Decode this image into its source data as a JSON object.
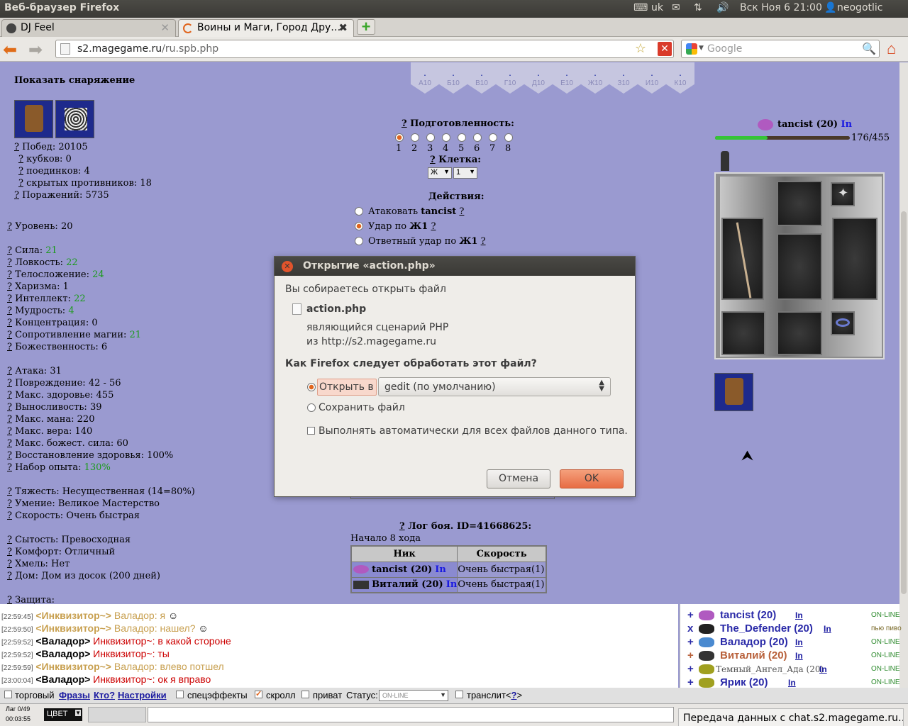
{
  "panel": {
    "title": "Веб-браузер Firefox",
    "keyboard": "uk",
    "datetime": "Вск Ноя 6 21:00",
    "user": "neogotlic"
  },
  "tabs": [
    {
      "label": "DJ Feel"
    },
    {
      "label": "Воины и Маги, Город Дру…"
    }
  ],
  "nav": {
    "url_domain": "s2.magegame.ru",
    "url_path": "/ru.spb.php",
    "search_placeholder": "Google"
  },
  "left": {
    "show_gear": "Показать снаряжение",
    "stats": [
      {
        "label": "Побед: ",
        "value": "20105"
      },
      {
        "label": "кубков: ",
        "value": "0"
      },
      {
        "label": "поединков: ",
        "value": "4"
      },
      {
        "label": "скрытых противников: ",
        "value": "18"
      },
      {
        "label": "Поражений: ",
        "value": "5735"
      },
      {
        "label": "Уровень: ",
        "value": "20"
      },
      {
        "label": "Сила: ",
        "value": "21"
      },
      {
        "label": "Ловкость: ",
        "value": "22"
      },
      {
        "label": "Телосложение: ",
        "value": "24"
      },
      {
        "label": "Харизма: ",
        "value": "1"
      },
      {
        "label": "Интеллект: ",
        "value": "22"
      },
      {
        "label": "Мудрость: ",
        "value": "4"
      },
      {
        "label": "Концентрация: ",
        "value": "0"
      },
      {
        "label": "Сопротивление магии: ",
        "value": "21"
      },
      {
        "label": "Божественность: ",
        "value": "6"
      },
      {
        "label": "Атака: ",
        "value": "31"
      },
      {
        "label": "Повреждение: ",
        "value": "42 - 56"
      },
      {
        "label": "Макс. здоровье: ",
        "value": "455"
      },
      {
        "label": "Выносливость: ",
        "value": "39"
      },
      {
        "label": "Макс. мана: ",
        "value": "220"
      },
      {
        "label": "Макс. вера: ",
        "value": "140"
      },
      {
        "label": "Макс. божест. сила: ",
        "value": "60"
      },
      {
        "label": "Восстановление здоровья: ",
        "value": "100%"
      },
      {
        "label": "Набор опыта: ",
        "value": "130%"
      },
      {
        "label": "Тяжесть: ",
        "value": "Несущественная (14=80%)"
      },
      {
        "label": "Умение: ",
        "value": "Великое Мастерство"
      },
      {
        "label": "Скорость: ",
        "value": "Очень быстрая"
      },
      {
        "label": "Сытость: ",
        "value": "Превосходная"
      },
      {
        "label": "Комфорт: ",
        "value": "Отличный"
      },
      {
        "label": "Хмель: ",
        "value": "Нет"
      },
      {
        "label": "Дом: ",
        "value": "Дом из досок (200 дней)"
      },
      {
        "label": "Защита:",
        "value": ""
      }
    ]
  },
  "cells": [
    "А10",
    "Б10",
    "В10",
    "Г10",
    "Д10",
    "Е10",
    "Ж10",
    "З10",
    "И10",
    "К10"
  ],
  "prep": {
    "title": "Подготовленность:",
    "levels": [
      "1",
      "2",
      "3",
      "4",
      "5",
      "6",
      "7",
      "8"
    ],
    "cell_title": "Клетка:",
    "cell_col": "Ж",
    "cell_row": "1"
  },
  "actions": {
    "title": "Действия:",
    "a1": "Атаковать ",
    "a1b": "tancist",
    "a2": "Удар по ",
    "a2b": "Ж1",
    "a3": "Ответный удар по ",
    "a3b": "Ж1"
  },
  "player": {
    "name": "tancist (20)",
    "link": "In",
    "hp": "176/455",
    "hp_fraction": 0.387
  },
  "log": {
    "title": "Лог боя. ID=41668625:",
    "turn": "Начало 8 хода",
    "col_nick": "Ник",
    "col_speed": "Скорость",
    "rows": [
      {
        "nick": "tancist (20)",
        "link": "In",
        "speed": "Очень быстрая(1)"
      },
      {
        "nick": "Виталий (20)",
        "link": "In",
        "speed": "Очень быстрая(1)"
      }
    ]
  },
  "chat": [
    {
      "time": "[22:59:45]",
      "nick": "<Инквизитор~>",
      "msg": " Валадор: я",
      "inq": true
    },
    {
      "time": "[22:59:50]",
      "nick": "<Инквизитор~>",
      "msg": " Валадор: нашел?",
      "inq": true
    },
    {
      "time": "[22:59:52]",
      "nick": "<Валадор>",
      "msg": " Инквизитор~: в какой стороне",
      "inq": false
    },
    {
      "time": "[22:59:52]",
      "nick": "<Валадор>",
      "msg": " Инквизитор~: ты",
      "inq": false
    },
    {
      "time": "[22:59:59]",
      "nick": "<Инквизитор~>",
      "msg": " Валадор: влево потшел",
      "inq": true
    },
    {
      "time": "[23:00:04]",
      "nick": "<Валадор>",
      "msg": " Инквизитор~: ок я вправо",
      "inq": false
    }
  ],
  "users": [
    {
      "sign": "+",
      "name": "tancist (20)",
      "link": "In",
      "status": "ON-LINE"
    },
    {
      "sign": "x",
      "name": "The_Defender (20)",
      "link": "In",
      "status": "пью пиво"
    },
    {
      "sign": "+",
      "name": "Валадор (20)",
      "link": "In",
      "status": "ON-LINE"
    },
    {
      "sign": "+",
      "name": "Виталий (20)",
      "link": "In",
      "status": "ON-LINE"
    },
    {
      "sign": "+",
      "name": "Темный_Ангел_Ада (20)",
      "link": "In",
      "status": "ON-LINE"
    },
    {
      "sign": "+",
      "name": "Ярик (20)",
      "link": "In",
      "status": "ON-LINE"
    }
  ],
  "chatbar": {
    "trade": "торговый",
    "phrases": "Фразы",
    "who": "Кто?",
    "settings": "Настройки",
    "effects": "спецэффекты",
    "scroll": "скролл",
    "private": "приват",
    "status_label": "Статус:",
    "status_value": "ON-LINE",
    "translit": "транслит<",
    "translit_q": "?",
    "translit_end": ">"
  },
  "bottom": {
    "lag": "Лаг 0/49",
    "time": "00:03:55",
    "color": "ЦВЕТ",
    "status_text": "Передача данных с chat.s2.magegame.ru…"
  },
  "dialog": {
    "title": "Открытие «action.php»",
    "intro": "Вы собираетесь открыть файл",
    "filename": "action.php",
    "type": "являющийся  сценарий PHP",
    "from": "из http://s2.magegame.ru",
    "question": "Как Firefox следует обработать этот файл?",
    "open_with": "Открыть в",
    "app": "gedit (по умолчанию)",
    "save": "Сохранить файл",
    "auto": "Выполнять автоматически для всех файлов данного типа.",
    "cancel": "Отмена",
    "ok": "OK"
  }
}
